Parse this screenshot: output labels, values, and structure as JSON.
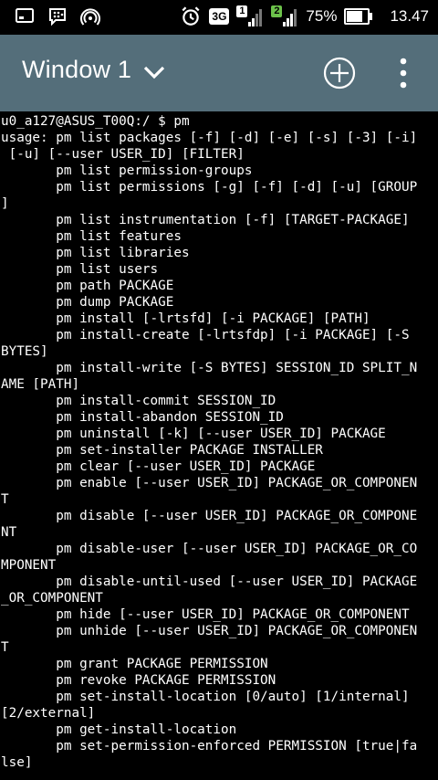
{
  "status_bar": {
    "left_icons": [
      "screen-icon",
      "bbm-icon",
      "hotspot-icon"
    ],
    "network_type": "3G",
    "sim1_label": "1",
    "sim2_label": "2",
    "battery_percent_text": "75%",
    "battery_level": 0.75,
    "time": "13.47"
  },
  "toolbar": {
    "window_title": "Window 1",
    "background_color": "#546e7a"
  },
  "terminal": {
    "lines": [
      "u0_a127@ASUS_T00Q:/ $ pm",
      "usage: pm list packages [-f] [-d] [-e] [-s] [-3] [-i]",
      " [-u] [--user USER_ID] [FILTER]",
      "       pm list permission-groups",
      "       pm list permissions [-g] [-f] [-d] [-u] [GROUP",
      "]",
      "       pm list instrumentation [-f] [TARGET-PACKAGE]",
      "       pm list features",
      "       pm list libraries",
      "       pm list users",
      "       pm path PACKAGE",
      "       pm dump PACKAGE",
      "       pm install [-lrtsfd] [-i PACKAGE] [PATH]",
      "       pm install-create [-lrtsfdp] [-i PACKAGE] [-S",
      "BYTES]",
      "       pm install-write [-S BYTES] SESSION_ID SPLIT_N",
      "AME [PATH]",
      "       pm install-commit SESSION_ID",
      "       pm install-abandon SESSION_ID",
      "       pm uninstall [-k] [--user USER_ID] PACKAGE",
      "       pm set-installer PACKAGE INSTALLER",
      "       pm clear [--user USER_ID] PACKAGE",
      "       pm enable [--user USER_ID] PACKAGE_OR_COMPONEN",
      "T",
      "       pm disable [--user USER_ID] PACKAGE_OR_COMPONE",
      "NT",
      "       pm disable-user [--user USER_ID] PACKAGE_OR_CO",
      "MPONENT",
      "       pm disable-until-used [--user USER_ID] PACKAGE",
      "_OR_COMPONENT",
      "       pm hide [--user USER_ID] PACKAGE_OR_COMPONENT",
      "       pm unhide [--user USER_ID] PACKAGE_OR_COMPONEN",
      "T",
      "       pm grant PACKAGE PERMISSION",
      "       pm revoke PACKAGE PERMISSION",
      "       pm set-install-location [0/auto] [1/internal]",
      "[2/external]",
      "       pm get-install-location",
      "       pm set-permission-enforced PERMISSION [true|fa",
      "lse]"
    ]
  }
}
